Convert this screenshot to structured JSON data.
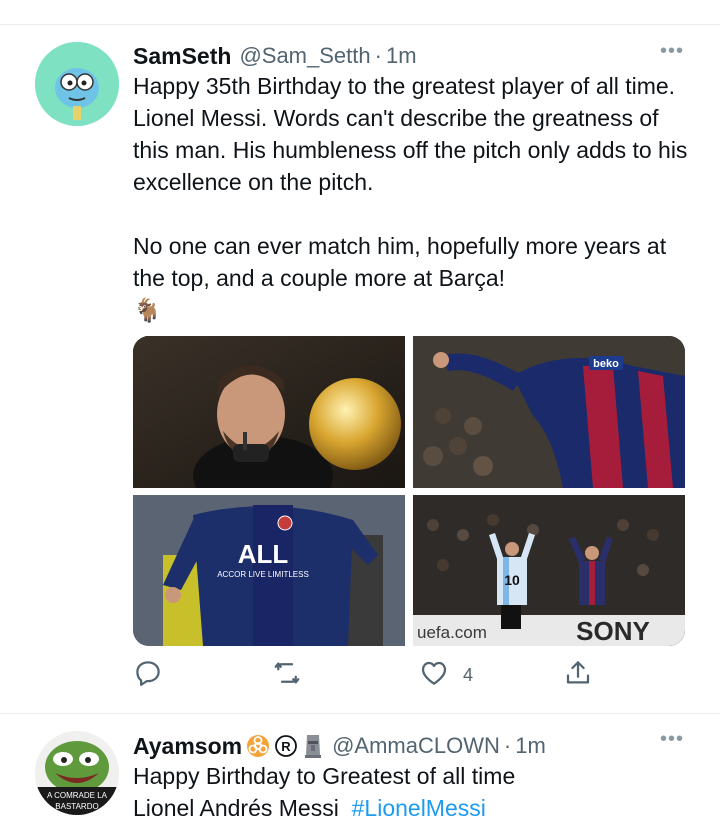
{
  "tweets": [
    {
      "display_name": "SamSeth",
      "handle": "@Sam_Setth",
      "separator": "·",
      "time": "1m",
      "more": "•••",
      "text_lines": [
        "Happy 35th Birthday to the greatest player of all time. Lionel Messi. Words can't describe the greatness of this man. His humbleness off the pitch only adds to his excellence on the pitch.",
        "No one can ever match him, hopefully more years at the top, and a couple more at Barça!"
      ],
      "emoji": "🐐",
      "media": {
        "image1": {
          "icon": "messi-ballon-dor-photo"
        },
        "image2": {
          "icon": "messi-barcelona-photo",
          "sponsor": "beko"
        },
        "image3": {
          "icon": "messi-psg-photo",
          "shirt_text": "ALL",
          "shirt_subtext": "ACCOR LIVE LIMITLESS"
        },
        "image4": {
          "icon": "messi-applauding-photo",
          "shirt_number": "10",
          "banner_left": "uefa.com",
          "banner_right": "SONY"
        }
      },
      "actions": {
        "reply": {
          "icon": "reply-icon"
        },
        "retweet": {
          "icon": "retweet-icon"
        },
        "like": {
          "icon": "heart-icon",
          "count": "4"
        },
        "share": {
          "icon": "share-icon"
        }
      }
    },
    {
      "display_name": "Ayamsom",
      "badges": [
        "☣️",
        "®",
        "🗿"
      ],
      "handle": "@AmmaCLOWN",
      "separator": "·",
      "time": "1m",
      "more": "•••",
      "text_lines": [
        "Happy Birthday to Greatest of all time",
        "Lionel Andrés Messi"
      ],
      "hashtag": "#LionelMessi",
      "avatar_caption_1": "A COMRADE LA",
      "avatar_caption_2": "BASTARDO"
    }
  ],
  "colors": {
    "accent": "#1d9bf0",
    "secondary_text": "#536471",
    "divider": "#e6ecf0"
  }
}
